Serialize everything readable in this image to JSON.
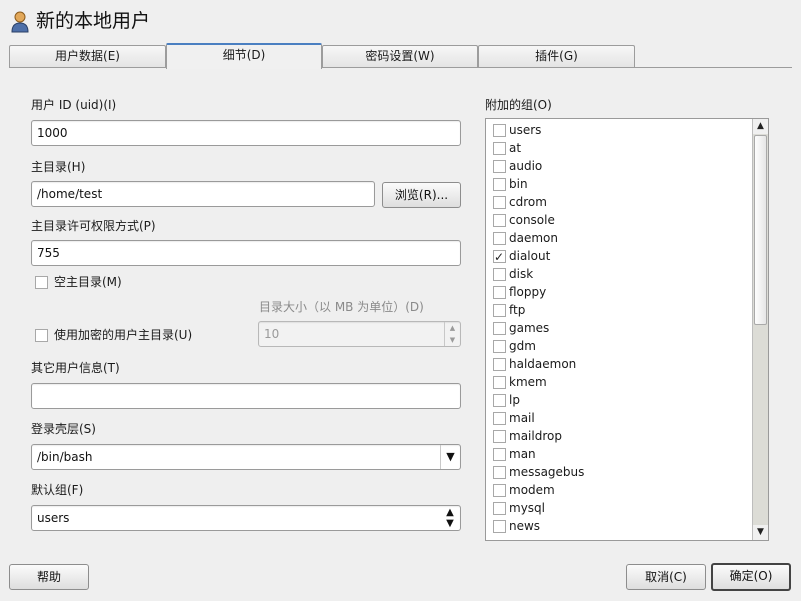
{
  "window": {
    "title": "新的本地用户",
    "icon": "user-icon"
  },
  "tabs": [
    {
      "label": "用户数据(E)",
      "active": false
    },
    {
      "label": "细节(D)",
      "active": true
    },
    {
      "label": "密码设置(W)",
      "active": false
    },
    {
      "label": "插件(G)",
      "active": false
    }
  ],
  "form": {
    "uid": {
      "label": "用户 ID (uid)(I)",
      "value": "1000"
    },
    "home": {
      "label": "主目录(H)",
      "value": "/home/test",
      "browse_label": "浏览(R)..."
    },
    "home_perm": {
      "label": "主目录许可权限方式(P)",
      "value": "755"
    },
    "empty_home": {
      "label": "空主目录(M)",
      "checked": false
    },
    "dir_size": {
      "label": "目录大小（以 MB 为单位）(D)",
      "value": "10"
    },
    "encrypted_home": {
      "label": "使用加密的用户主目录(U)",
      "checked": false
    },
    "other_info": {
      "label": "其它用户信息(T)",
      "value": ""
    },
    "login_shell": {
      "label": "登录壳层(S)",
      "value": "/bin/bash"
    },
    "default_group": {
      "label": "默认组(F)",
      "value": "users"
    }
  },
  "groups": {
    "label": "附加的组(O)",
    "items": [
      {
        "name": "users",
        "checked": false
      },
      {
        "name": "at",
        "checked": false
      },
      {
        "name": "audio",
        "checked": false
      },
      {
        "name": "bin",
        "checked": false
      },
      {
        "name": "cdrom",
        "checked": false
      },
      {
        "name": "console",
        "checked": false
      },
      {
        "name": "daemon",
        "checked": false
      },
      {
        "name": "dialout",
        "checked": true
      },
      {
        "name": "disk",
        "checked": false
      },
      {
        "name": "floppy",
        "checked": false
      },
      {
        "name": "ftp",
        "checked": false
      },
      {
        "name": "games",
        "checked": false
      },
      {
        "name": "gdm",
        "checked": false
      },
      {
        "name": "haldaemon",
        "checked": false
      },
      {
        "name": "kmem",
        "checked": false
      },
      {
        "name": "lp",
        "checked": false
      },
      {
        "name": "mail",
        "checked": false
      },
      {
        "name": "maildrop",
        "checked": false
      },
      {
        "name": "man",
        "checked": false
      },
      {
        "name": "messagebus",
        "checked": false
      },
      {
        "name": "modem",
        "checked": false
      },
      {
        "name": "mysql",
        "checked": false
      },
      {
        "name": "news",
        "checked": false
      }
    ]
  },
  "buttons": {
    "help": "帮助",
    "cancel": "取消(C)",
    "ok": "确定(O)"
  }
}
